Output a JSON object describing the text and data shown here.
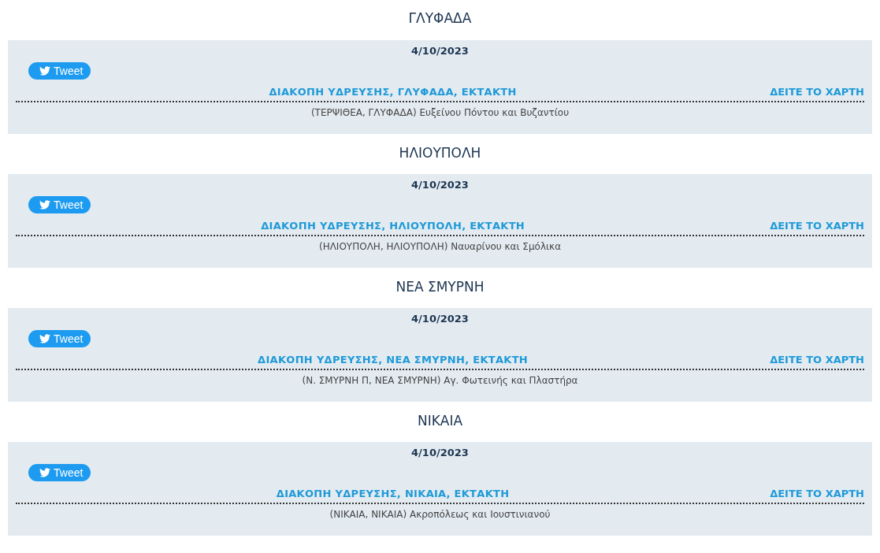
{
  "sections": [
    {
      "area": "ΓΛΥΦΑΔΑ",
      "date": "4/10/2023",
      "tweet": "Tweet",
      "title": "ΔΙΑΚΟΠΗ ΥΔΡΕΥΣΗΣ, ΓΛΥΦΑΔΑ, ΕΚΤΑΚΤΗ",
      "map_link": "ΔΕΙΤΕ ΤΟ ΧΑΡΤΗ",
      "address": "(ΤΕΡΨΙΘΕΑ, ΓΛΥΦΑΔΑ) Ευξείνου Πόντου και Βυζαντίου"
    },
    {
      "area": "ΗΛΙΟΥΠΟΛΗ",
      "date": "4/10/2023",
      "tweet": "Tweet",
      "title": "ΔΙΑΚΟΠΗ ΥΔΡΕΥΣΗΣ, ΗΛΙΟΥΠΟΛΗ, ΕΚΤΑΚΤΗ",
      "map_link": "ΔΕΙΤΕ ΤΟ ΧΑΡΤΗ",
      "address": "(ΗΛΙΟΥΠΟΛΗ, ΗΛΙΟΥΠΟΛΗ) Ναυαρίνου και Σμόλικα"
    },
    {
      "area": "ΝΕΑ ΣΜΥΡΝΗ",
      "date": "4/10/2023",
      "tweet": "Tweet",
      "title": "ΔΙΑΚΟΠΗ ΥΔΡΕΥΣΗΣ, ΝΕΑ ΣΜΥΡΝΗ, ΕΚΤΑΚΤΗ",
      "map_link": "ΔΕΙΤΕ ΤΟ ΧΑΡΤΗ",
      "address": "(Ν. ΣΜΥΡΝΗ Π, ΝΕΑ ΣΜΥΡΝΗ) Αγ. Φωτεινής και Πλαστήρα"
    },
    {
      "area": "ΝΙΚΑΙΑ",
      "date": "4/10/2023",
      "tweet": "Tweet",
      "title": "ΔΙΑΚΟΠΗ ΥΔΡΕΥΣΗΣ, ΝΙΚΑΙΑ, ΕΚΤΑΚΤΗ",
      "map_link": "ΔΕΙΤΕ ΤΟ ΧΑΡΤΗ",
      "address": "(ΝΙΚΑΙΑ, ΝΙΚΑΙΑ) Ακροπόλεως και Ιουστινιανού"
    }
  ]
}
